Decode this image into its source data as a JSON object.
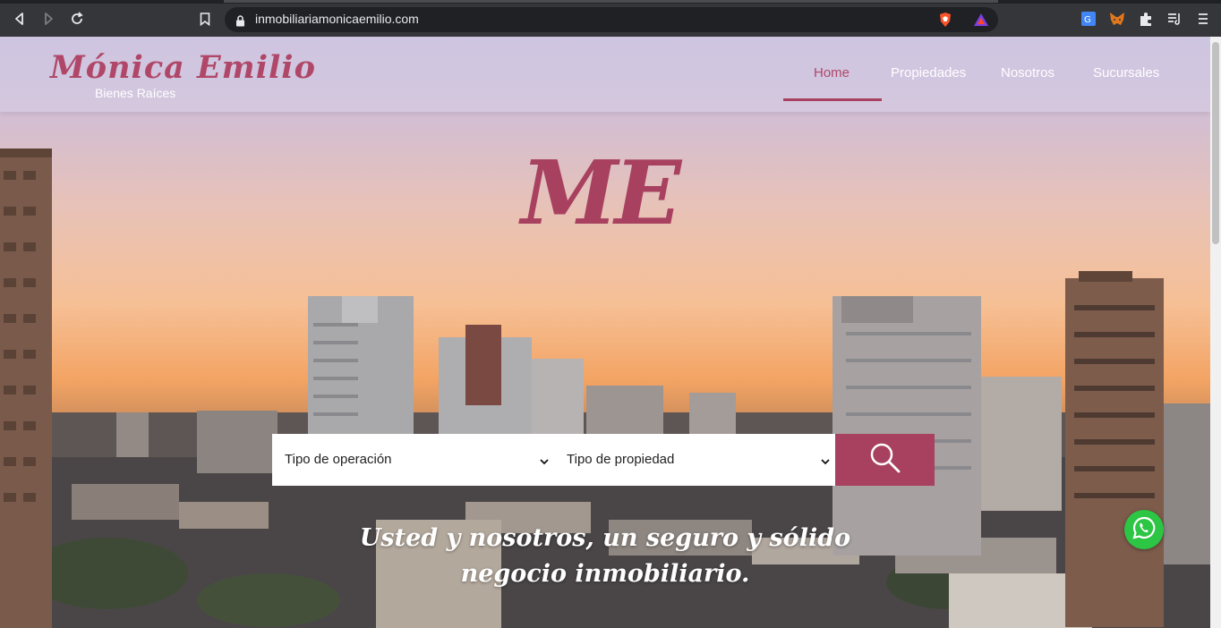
{
  "browser": {
    "url": "inmobiliariamonicaemilio.com"
  },
  "site": {
    "brand_name": "Mónica Emilio",
    "brand_subtitle": "Bienes Raíces",
    "monogram": "ME",
    "accent_color": "#a8405f",
    "nav": [
      {
        "label": "Home",
        "active": true
      },
      {
        "label": "Propiedades",
        "active": false
      },
      {
        "label": "Nosotros",
        "active": false
      },
      {
        "label": "Sucursales",
        "active": false
      }
    ],
    "search": {
      "operation_select": "Tipo de operación",
      "property_select": "Tipo de propiedad",
      "button_icon": "search-icon"
    },
    "tagline": {
      "line1": "Usted y nosotros, un seguro y sólido",
      "line2": "negocio inmobiliario."
    },
    "whatsapp_icon": "whatsapp-icon"
  }
}
